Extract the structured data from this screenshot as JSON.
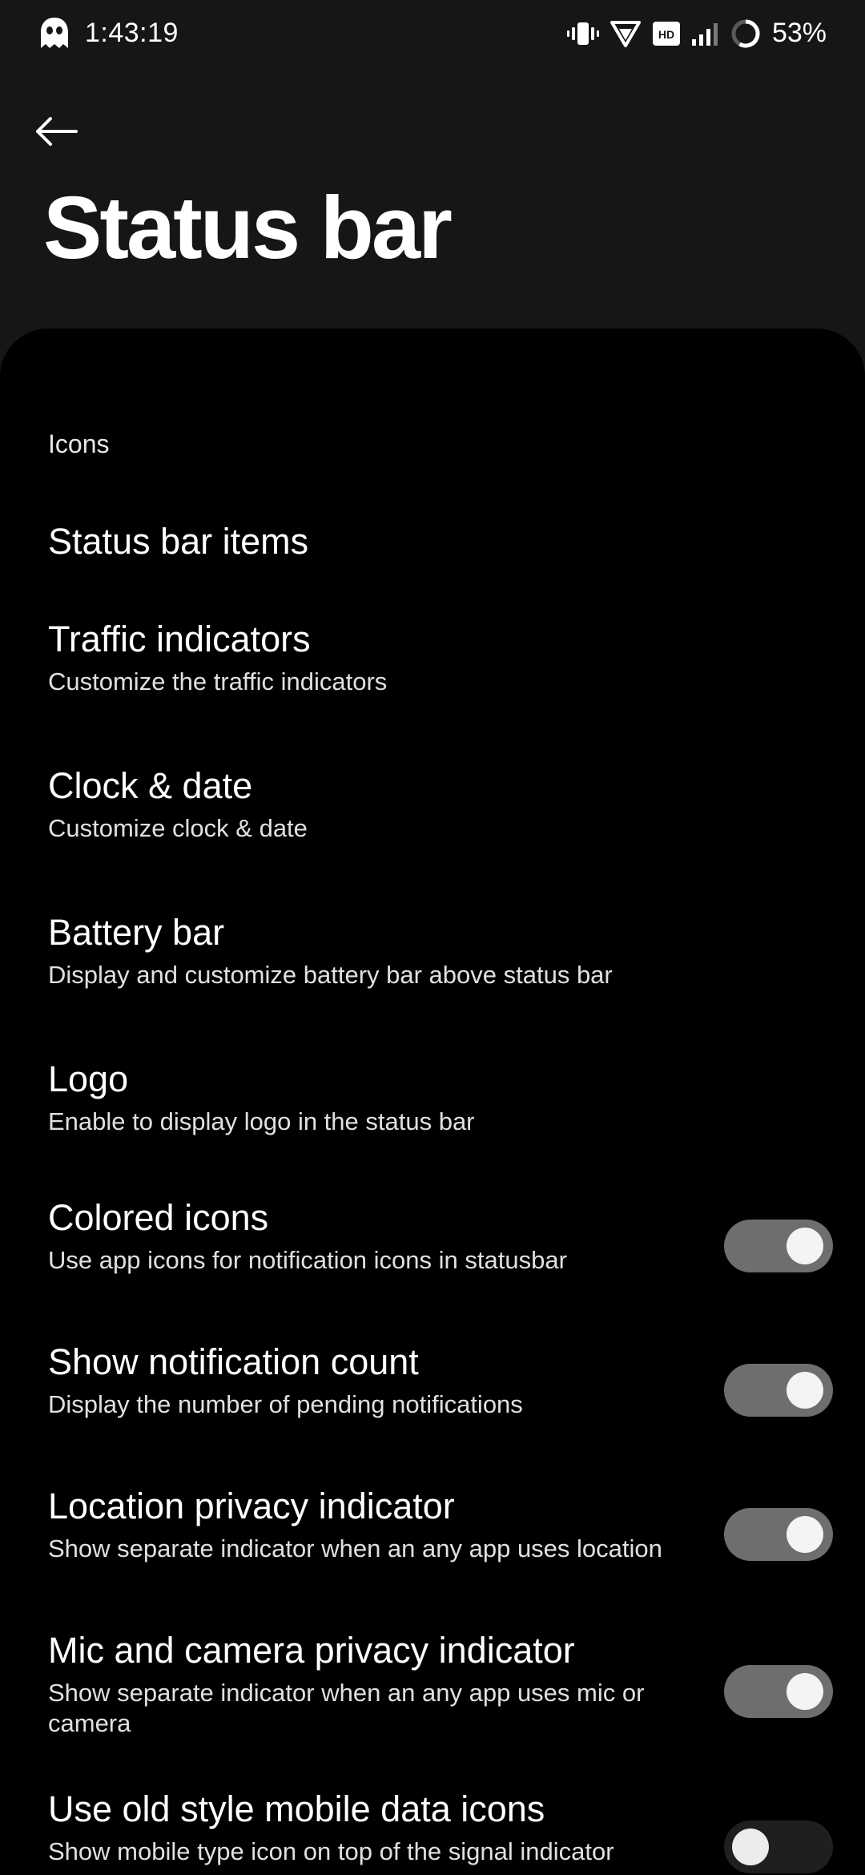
{
  "status_bar": {
    "time": "1:43:19",
    "battery_percent": "53%",
    "icons": [
      "ghost-icon",
      "vibrate-icon",
      "wifi-icon",
      "hd-icon",
      "signal-icon",
      "battery-ring-icon"
    ]
  },
  "header": {
    "title": "Status bar"
  },
  "section": {
    "label": "Icons"
  },
  "prefs": [
    {
      "title": "Status bar items",
      "summary": ""
    },
    {
      "title": "Traffic indicators",
      "summary": "Customize the traffic indicators"
    },
    {
      "title": "Clock & date",
      "summary": "Customize clock & date"
    },
    {
      "title": "Battery bar",
      "summary": "Display and customize battery bar above status bar"
    },
    {
      "title": "Logo",
      "summary": "Enable to display logo in the status bar"
    },
    {
      "title": "Colored icons",
      "summary": "Use app icons for notification icons in statusbar",
      "switch": "on"
    },
    {
      "title": "Show notification count",
      "summary": "Display the number of pending notifications",
      "switch": "on"
    },
    {
      "title": "Location privacy indicator",
      "summary": "Show separate indicator when an any app uses location",
      "switch": "on"
    },
    {
      "title": "Mic and camera privacy indicator",
      "summary": "Show separate indicator when an any app uses mic or camera",
      "switch": "on"
    },
    {
      "title": "Use old style mobile data icons",
      "summary": "Show mobile type icon on top of the signal indicator",
      "switch": "off"
    }
  ]
}
